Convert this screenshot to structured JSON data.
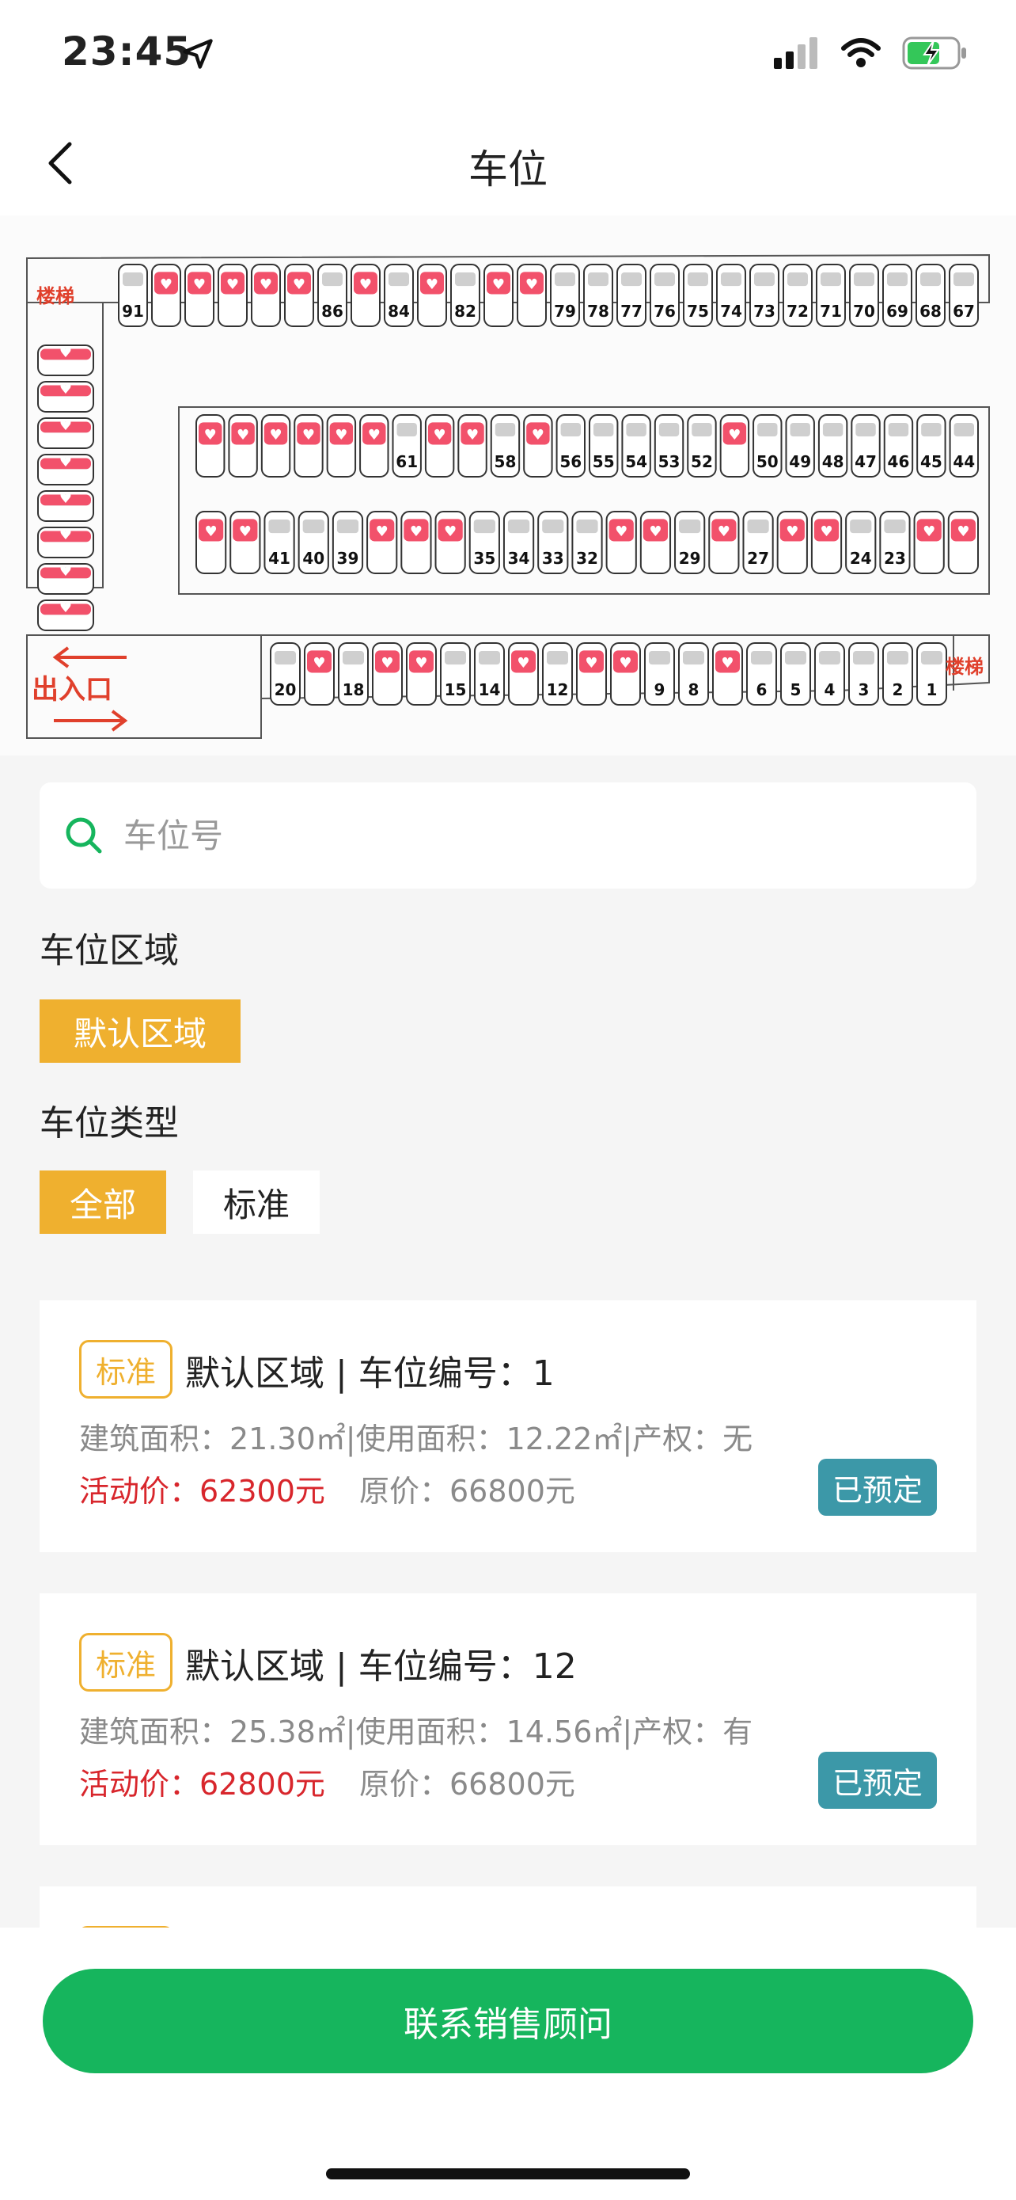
{
  "status_bar": {
    "time": "23:45",
    "icons": [
      "location-arrow-icon",
      "signal-icon",
      "wifi-icon",
      "battery-charging-icon"
    ]
  },
  "nav": {
    "title": "车位",
    "back_icon": "chevron-left-icon"
  },
  "map": {
    "stair_label": "楼梯",
    "entrance_label": "出入口",
    "rows": [
      [
        "91",
        "",
        "",
        "",
        "",
        "",
        "86",
        "",
        "84",
        "",
        "82",
        "",
        "",
        "79",
        "78",
        "77",
        "76",
        "75",
        "74",
        "73",
        "72",
        "71",
        "70",
        "69",
        "68",
        "67"
      ],
      [
        "",
        "",
        "",
        "",
        "",
        "",
        "61",
        "",
        "",
        "58",
        "",
        "56",
        "55",
        "54",
        "53",
        "52",
        "",
        "50",
        "49",
        "48",
        "47",
        "46",
        "45",
        "44"
      ],
      [
        "",
        "",
        "41",
        "40",
        "39",
        "",
        "",
        "",
        "35",
        "34",
        "33",
        "32",
        "",
        "",
        "29",
        "",
        "27",
        "",
        "",
        "24",
        "23",
        "",
        ""
      ],
      [
        "20",
        "",
        "18",
        "",
        "",
        "15",
        "14",
        "",
        "12",
        "",
        "",
        "9",
        "8",
        "",
        "6",
        "5",
        "4",
        "3",
        "2",
        "1"
      ]
    ],
    "reserved_color": "#f2516b"
  },
  "search": {
    "placeholder": "车位号",
    "value": ""
  },
  "filters": {
    "area_label": "车位区域",
    "area_options": [
      {
        "label": "默认区域",
        "selected": true
      }
    ],
    "type_label": "车位类型",
    "type_options": [
      {
        "label": "全部",
        "selected": true
      },
      {
        "label": "标准",
        "selected": false
      }
    ]
  },
  "listings": [
    {
      "tag": "标准",
      "title": "默认区域 | 车位编号：1",
      "spec": "建筑面积：21.30㎡|使用面积：12.22㎡|产权：无",
      "price": "活动价：62300元",
      "original": "原价：66800元",
      "status": "已预定"
    },
    {
      "tag": "标准",
      "title": "默认区域 | 车位编号：12",
      "spec": "建筑面积：25.38㎡|使用面积：14.56㎡|产权：有",
      "price": "活动价：62800元",
      "original": "原价：66800元",
      "status": "已预定"
    }
  ],
  "bottom": {
    "contact_label": "联系销售顾问"
  },
  "colors": {
    "accent": "#efb02f",
    "primary_green": "#16b55d",
    "status_teal": "#3c98a8",
    "price_red": "#d8262c"
  }
}
